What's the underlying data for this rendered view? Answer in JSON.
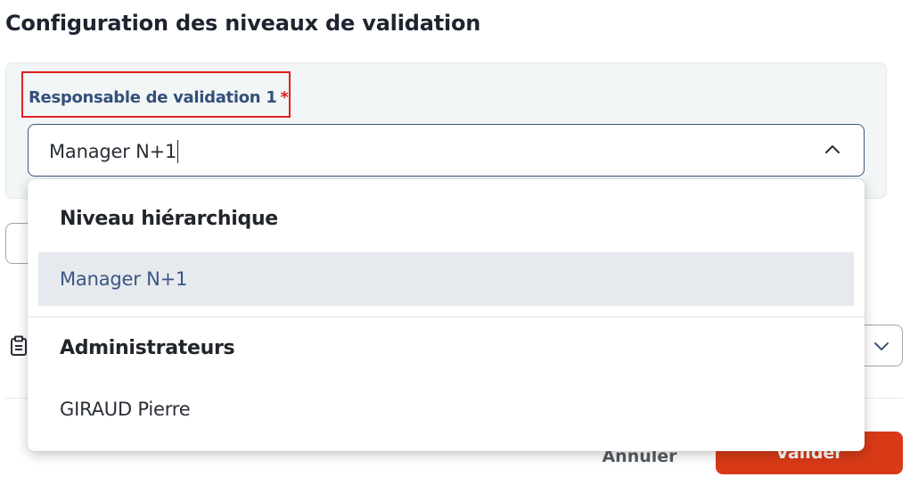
{
  "page": {
    "title": "Configuration des niveaux de validation"
  },
  "field": {
    "label": "Responsable de validation 1",
    "required_marker": "*",
    "value": "Manager N+1"
  },
  "dropdown": {
    "groups": [
      {
        "header": "Niveau hiérarchique",
        "options": [
          {
            "label": "Manager N+1",
            "selected": true
          }
        ]
      },
      {
        "header": "Administrateurs",
        "options": [
          {
            "label": "GIRAUD Pierre",
            "selected": false
          }
        ]
      }
    ]
  },
  "footer": {
    "cancel_label": "Annuler",
    "validate_label": "Valider"
  },
  "colors": {
    "accent": "#d83a17",
    "label_blue": "#34507a",
    "required_red": "#e02020",
    "selected_bg": "#e6e9ee"
  },
  "icons": {
    "select_chevron": "chevron-up-icon",
    "side_icon": "clipboard-icon",
    "secondary_chevron": "chevron-down-icon"
  }
}
